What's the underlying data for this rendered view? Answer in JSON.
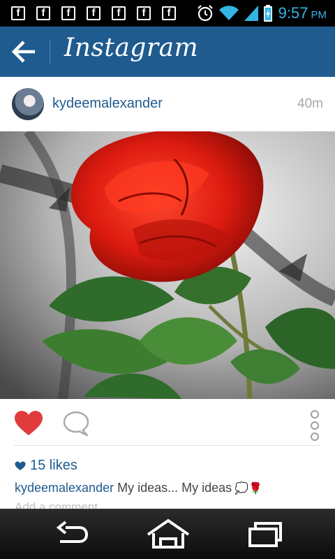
{
  "status_bar": {
    "notification_icons": [
      "f",
      "f",
      "f",
      "f",
      "f",
      "f",
      "f"
    ],
    "system_icons": [
      "alarm-icon",
      "wifi-icon",
      "signal-icon",
      "battery-charging-icon"
    ],
    "time": "9:57",
    "ampm": "PM",
    "accent_color": "#33b5e5"
  },
  "app_bar": {
    "title": "Instagram",
    "background_color": "#1f5b8f",
    "back_icon": "arrow-left-icon"
  },
  "post": {
    "username": "kydeemalexander",
    "time_ago": "40m",
    "photo_subject": "red-rose-photo",
    "likes_text": "15 likes",
    "caption_username": "kydeemalexander",
    "caption_text": "My ideas... My ideas",
    "caption_emoji": "💭🌹",
    "add_comment_placeholder": "Add a comment",
    "liked": true,
    "like_color": "#e03c3c"
  },
  "nav_bar": {
    "buttons": [
      "back-icon",
      "home-icon",
      "recent-apps-icon"
    ]
  }
}
